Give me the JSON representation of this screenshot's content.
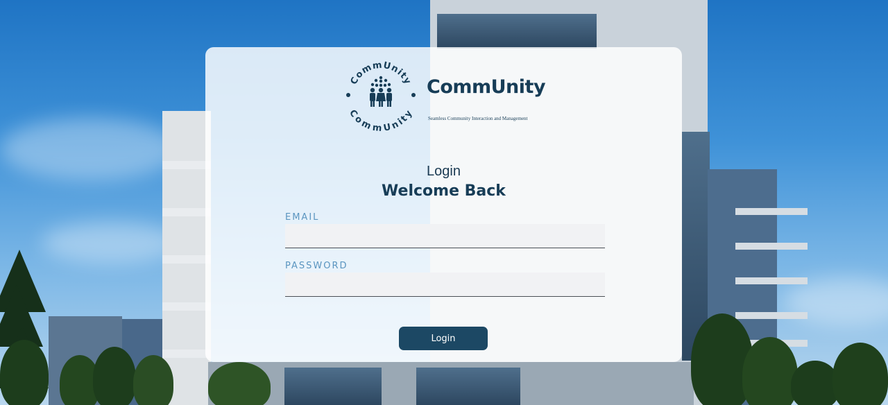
{
  "brand": {
    "name": "CommUnity",
    "tagline": "Seamless Community Interaction and Management",
    "logo_ring_text": "CommUnity"
  },
  "login_form": {
    "title": "Login",
    "subtitle": "Welcome Back",
    "email_label": "EMAIL",
    "email_value": "",
    "password_label": "PASSWORD",
    "password_value": "",
    "submit_label": "Login"
  },
  "colors": {
    "brand_navy": "#173d57",
    "button": "#1c4864",
    "label_blue": "#5a95c0"
  },
  "icons": [
    "community-people-icon"
  ]
}
